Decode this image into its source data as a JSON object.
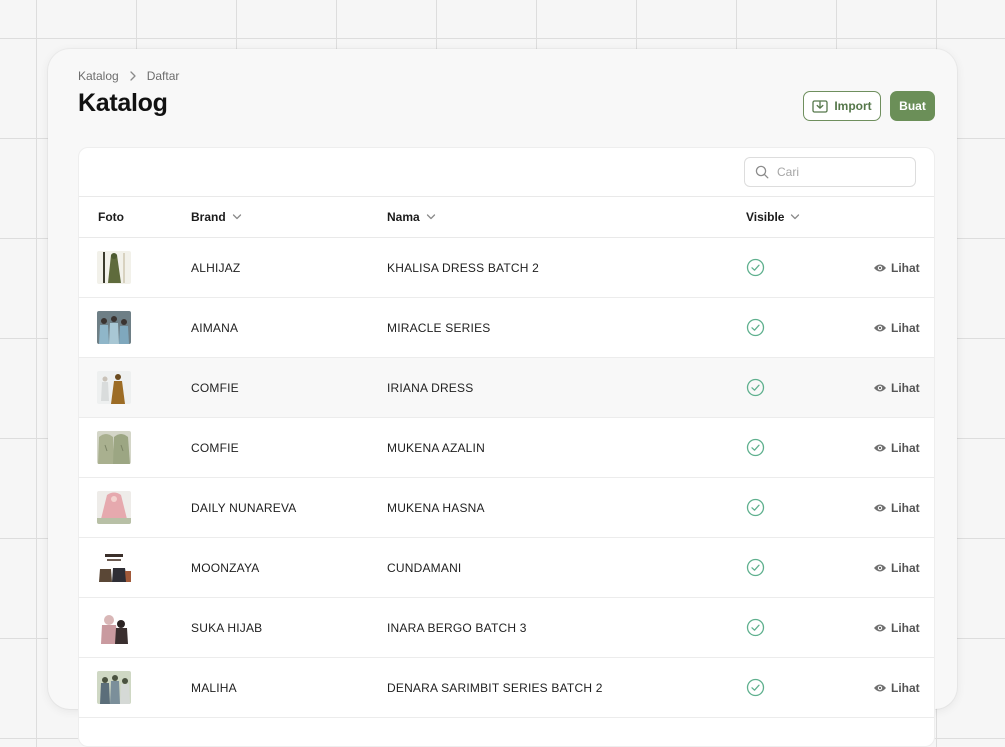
{
  "breadcrumb": {
    "root": "Katalog",
    "current": "Daftar"
  },
  "page": {
    "title": "Katalog"
  },
  "actions": {
    "import_label": "Import",
    "create_label": "Buat"
  },
  "search": {
    "placeholder": "Cari",
    "value": ""
  },
  "table": {
    "columns": {
      "photo": "Foto",
      "brand": "Brand",
      "name": "Nama",
      "visible": "Visible"
    },
    "rows": [
      {
        "brand": "ALHIJAZ",
        "name": "KHALISA DRESS BATCH 2",
        "visible": true,
        "action": "Lihat"
      },
      {
        "brand": "AIMANA",
        "name": "MIRACLE SERIES",
        "visible": true,
        "action": "Lihat"
      },
      {
        "brand": "COMFIE",
        "name": "IRIANA DRESS",
        "visible": true,
        "action": "Lihat"
      },
      {
        "brand": "COMFIE",
        "name": "MUKENA AZALIN",
        "visible": true,
        "action": "Lihat"
      },
      {
        "brand": "DAILY NUNAREVA",
        "name": "MUKENA HASNA",
        "visible": true,
        "action": "Lihat"
      },
      {
        "brand": "MOONZAYA",
        "name": "CUNDAMANI",
        "visible": true,
        "action": "Lihat"
      },
      {
        "brand": "SUKA HIJAB",
        "name": "INARA BERGO BATCH 3",
        "visible": true,
        "action": "Lihat"
      },
      {
        "brand": "MALIHA",
        "name": "DENARA SARIMBIT SERIES BATCH 2",
        "visible": true,
        "action": "Lihat"
      }
    ]
  },
  "colors": {
    "accent": "#6b8f58",
    "accent_text": "#55774a",
    "visible_check": "#5fb08e"
  },
  "icons": {
    "breadcrumb_separator": "chevron-right-icon",
    "import": "import-icon",
    "search": "search-icon",
    "sort": "chevron-down-icon",
    "visible": "check-circle-icon",
    "view": "eye-icon"
  }
}
